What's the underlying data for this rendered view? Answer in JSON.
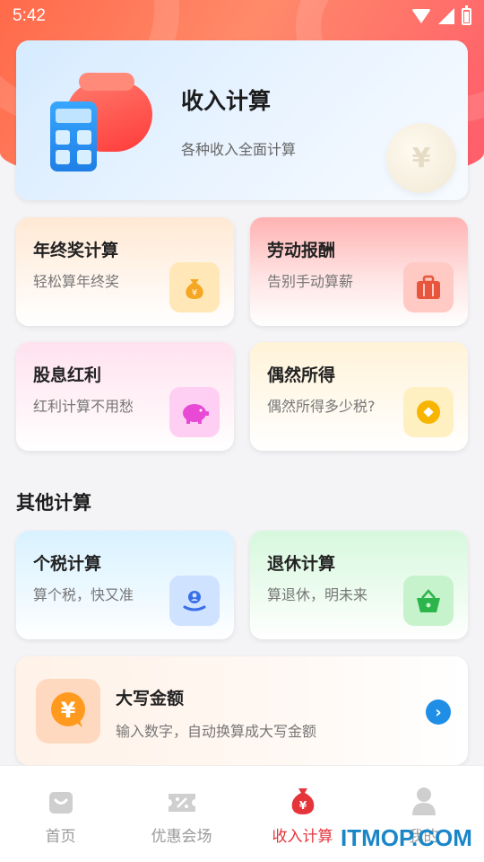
{
  "status_bar": {
    "time": "5:42"
  },
  "main_card": {
    "title": "收入计算",
    "subtitle": "各种收入全面计算",
    "coin_symbol": "¥"
  },
  "tiles": [
    {
      "title": "年终奖计算",
      "subtitle": "轻松算年终奖",
      "icon": "money-bag-icon",
      "icon_color": "#f5a623"
    },
    {
      "title": "劳动报酬",
      "subtitle": "告别手动算薪",
      "icon": "briefcase-icon",
      "icon_color": "#e8553d"
    },
    {
      "title": "股息红利",
      "subtitle": "红利计算不用愁",
      "icon": "piggy-bank-icon",
      "icon_color": "#e84ad6"
    },
    {
      "title": "偶然所得",
      "subtitle": "偶然所得多少税?",
      "icon": "coin-icon",
      "icon_color": "#f7b500"
    }
  ],
  "other_section": {
    "title": "其他计算",
    "tiles": [
      {
        "title": "个税计算",
        "subtitle": "算个税，快又准",
        "icon": "hand-person-icon",
        "icon_color": "#3a6ee8"
      },
      {
        "title": "退休计算",
        "subtitle": "算退休，明未来",
        "icon": "basket-icon",
        "icon_color": "#2bb54a"
      }
    ],
    "uppercase_card": {
      "title": "大写金额",
      "subtitle": "输入数字，自动换算成大写金额",
      "icon_symbol": "¥",
      "arrow": "›"
    }
  },
  "tabbar": {
    "items": [
      {
        "label": "首页",
        "icon": "home-icon",
        "active": false
      },
      {
        "label": "优惠会场",
        "icon": "coupon-icon",
        "active": false
      },
      {
        "label": "收入计算",
        "icon": "money-bag-icon",
        "active": true
      },
      {
        "label": "我的",
        "icon": "person-icon",
        "active": false
      }
    ]
  },
  "watermark": "ITMOP.COM",
  "colors": {
    "accent": "#e5343a",
    "header": "#ff6a4a"
  }
}
